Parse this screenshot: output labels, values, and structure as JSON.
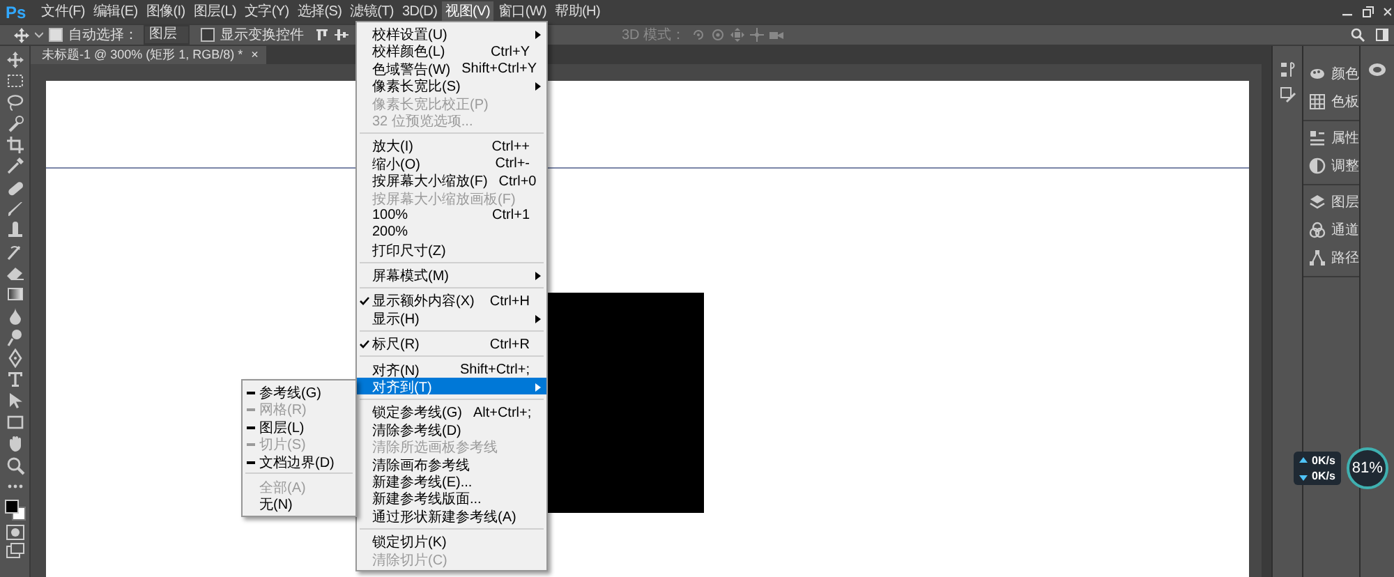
{
  "app_logo": "Ps",
  "menu_bar": [
    {
      "label": "文件(F)",
      "selected": false
    },
    {
      "label": "编辑(E)",
      "selected": false
    },
    {
      "label": "图像(I)",
      "selected": false
    },
    {
      "label": "图层(L)",
      "selected": false
    },
    {
      "label": "文字(Y)",
      "selected": false
    },
    {
      "label": "选择(S)",
      "selected": false
    },
    {
      "label": "滤镜(T)",
      "selected": false
    },
    {
      "label": "3D(D)",
      "selected": false
    },
    {
      "label": "视图(V)",
      "selected": true
    },
    {
      "label": "窗口(W)",
      "selected": false
    },
    {
      "label": "帮助(H)",
      "selected": false
    }
  ],
  "options_bar": {
    "auto_select": {
      "label": "自动选择：",
      "checked": true
    },
    "auto_select_target": "图层",
    "show_transform_controls": {
      "label": "显示变换控件",
      "checked": false
    },
    "mode_3d_label": "3D 模式："
  },
  "document_tab": {
    "title": "未标题-1 @ 300% (矩形 1, RGB/8) *",
    "close": "×"
  },
  "view_menu": [
    {
      "kind": "item",
      "label": "校样设置(U)",
      "submenu": true,
      "disabled": false,
      "checked": false,
      "selected": false
    },
    {
      "kind": "item",
      "label": "校样颜色(L)",
      "shortcut": "Ctrl+Y",
      "submenu": false,
      "disabled": false,
      "checked": false,
      "selected": false
    },
    {
      "kind": "item",
      "label": "色域警告(W)",
      "shortcut": "Shift+Ctrl+Y",
      "submenu": false,
      "disabled": false,
      "checked": false,
      "selected": false
    },
    {
      "kind": "item",
      "label": "像素长宽比(S)",
      "submenu": true,
      "disabled": false,
      "checked": false,
      "selected": false
    },
    {
      "kind": "item",
      "label": "像素长宽比校正(P)",
      "submenu": false,
      "disabled": true,
      "checked": false,
      "selected": false
    },
    {
      "kind": "item",
      "label": "32 位预览选项...",
      "submenu": false,
      "disabled": true,
      "checked": false,
      "selected": false
    },
    {
      "kind": "separator"
    },
    {
      "kind": "item",
      "label": "放大(I)",
      "shortcut": "Ctrl++",
      "submenu": false,
      "disabled": false,
      "checked": false,
      "selected": false
    },
    {
      "kind": "item",
      "label": "缩小(O)",
      "shortcut": "Ctrl+-",
      "submenu": false,
      "disabled": false,
      "checked": false,
      "selected": false
    },
    {
      "kind": "item",
      "label": "按屏幕大小缩放(F)",
      "shortcut": "Ctrl+0",
      "submenu": false,
      "disabled": false,
      "checked": false,
      "selected": false
    },
    {
      "kind": "item",
      "label": "按屏幕大小缩放画板(F)",
      "submenu": false,
      "disabled": true,
      "checked": false,
      "selected": false
    },
    {
      "kind": "item",
      "label": "100%",
      "shortcut": "Ctrl+1",
      "submenu": false,
      "disabled": false,
      "checked": false,
      "selected": false
    },
    {
      "kind": "item",
      "label": "200%",
      "submenu": false,
      "disabled": false,
      "checked": false,
      "selected": false
    },
    {
      "kind": "item",
      "label": "打印尺寸(Z)",
      "submenu": false,
      "disabled": false,
      "checked": false,
      "selected": false
    },
    {
      "kind": "separator"
    },
    {
      "kind": "item",
      "label": "屏幕模式(M)",
      "submenu": true,
      "disabled": false,
      "checked": false,
      "selected": false
    },
    {
      "kind": "separator"
    },
    {
      "kind": "item",
      "label": "显示额外内容(X)",
      "shortcut": "Ctrl+H",
      "submenu": false,
      "disabled": false,
      "checked": true,
      "selected": false
    },
    {
      "kind": "item",
      "label": "显示(H)",
      "submenu": true,
      "disabled": false,
      "checked": false,
      "selected": false
    },
    {
      "kind": "separator"
    },
    {
      "kind": "item",
      "label": "标尺(R)",
      "shortcut": "Ctrl+R",
      "submenu": false,
      "disabled": false,
      "checked": true,
      "selected": false
    },
    {
      "kind": "separator"
    },
    {
      "kind": "item",
      "label": "对齐(N)",
      "shortcut": "Shift+Ctrl+;",
      "submenu": false,
      "disabled": false,
      "checked": false,
      "selected": false
    },
    {
      "kind": "item",
      "label": "对齐到(T)",
      "submenu": true,
      "disabled": false,
      "checked": false,
      "selected": true
    },
    {
      "kind": "separator"
    },
    {
      "kind": "item",
      "label": "锁定参考线(G)",
      "shortcut": "Alt+Ctrl+;",
      "submenu": false,
      "disabled": false,
      "checked": false,
      "selected": false
    },
    {
      "kind": "item",
      "label": "清除参考线(D)",
      "submenu": false,
      "disabled": false,
      "checked": false,
      "selected": false
    },
    {
      "kind": "item",
      "label": "清除所选画板参考线",
      "submenu": false,
      "disabled": true,
      "checked": false,
      "selected": false
    },
    {
      "kind": "item",
      "label": "清除画布参考线",
      "submenu": false,
      "disabled": false,
      "checked": false,
      "selected": false
    },
    {
      "kind": "item",
      "label": "新建参考线(E)...",
      "submenu": false,
      "disabled": false,
      "checked": false,
      "selected": false
    },
    {
      "kind": "item",
      "label": "新建参考线版面...",
      "submenu": false,
      "disabled": false,
      "checked": false,
      "selected": false
    },
    {
      "kind": "item",
      "label": "通过形状新建参考线(A)",
      "submenu": false,
      "disabled": false,
      "checked": false,
      "selected": false
    },
    {
      "kind": "separator"
    },
    {
      "kind": "item",
      "label": "锁定切片(K)",
      "submenu": false,
      "disabled": false,
      "checked": false,
      "selected": false
    },
    {
      "kind": "item",
      "label": "清除切片(C)",
      "submenu": false,
      "disabled": true,
      "checked": false,
      "selected": false
    }
  ],
  "snap_to_submenu": [
    {
      "kind": "item",
      "label": "参考线(G)",
      "disabled": false,
      "checked": true
    },
    {
      "kind": "item",
      "label": "网格(R)",
      "disabled": true,
      "checked": true
    },
    {
      "kind": "item",
      "label": "图层(L)",
      "disabled": false,
      "checked": true
    },
    {
      "kind": "item",
      "label": "切片(S)",
      "disabled": true,
      "checked": true
    },
    {
      "kind": "item",
      "label": "文档边界(D)",
      "disabled": false,
      "checked": true
    },
    {
      "kind": "separator"
    },
    {
      "kind": "item",
      "label": "全部(A)",
      "disabled": true,
      "checked": false
    },
    {
      "kind": "item",
      "label": "无(N)",
      "disabled": false,
      "checked": false
    }
  ],
  "panels": [
    {
      "items": [
        {
          "label": "颜色"
        },
        {
          "label": "色板"
        }
      ]
    },
    {
      "items": [
        {
          "label": "属性"
        },
        {
          "label": "调整"
        }
      ]
    },
    {
      "items": [
        {
          "label": "图层"
        },
        {
          "label": "通道"
        },
        {
          "label": "路径"
        }
      ]
    }
  ],
  "network_monitor": {
    "upload": "0K/s",
    "download": "0K/s",
    "percent": "81%"
  }
}
